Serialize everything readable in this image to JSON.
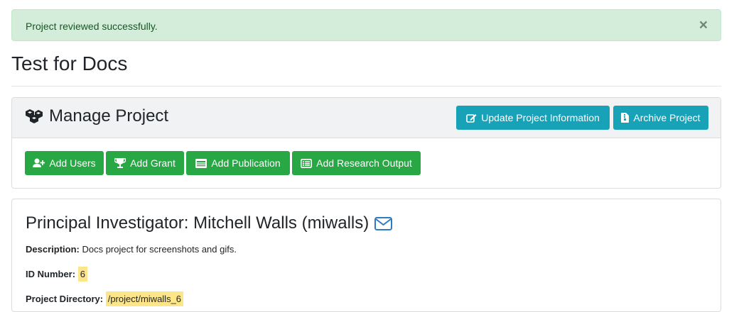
{
  "alert": {
    "message": "Project reviewed successfully.",
    "close": "×"
  },
  "page": {
    "title": "Test for Docs"
  },
  "manage": {
    "title": "Manage Project",
    "update_label": "Update Project Information",
    "archive_label": "Archive Project",
    "actions": [
      {
        "label": "Add Users",
        "icon": "user-plus-icon"
      },
      {
        "label": "Add Grant",
        "icon": "trophy-icon"
      },
      {
        "label": "Add Publication",
        "icon": "newspaper-icon"
      },
      {
        "label": "Add Research Output",
        "icon": "list-alt-icon"
      }
    ]
  },
  "details": {
    "pi_heading": "Principal Investigator: Mitchell Walls (miwalls)",
    "description_label": "Description:",
    "description_value": "Docs project for screenshots and gifs.",
    "id_label": "ID Number:",
    "id_value": "6",
    "dir_label": "Project Directory:",
    "dir_value": "/project/miwalls_6"
  },
  "colors": {
    "info": "#17a2b8",
    "success": "#28a745",
    "alert_bg": "#d4edda",
    "highlight": "#fde68a",
    "link": "#2d7bc4"
  }
}
